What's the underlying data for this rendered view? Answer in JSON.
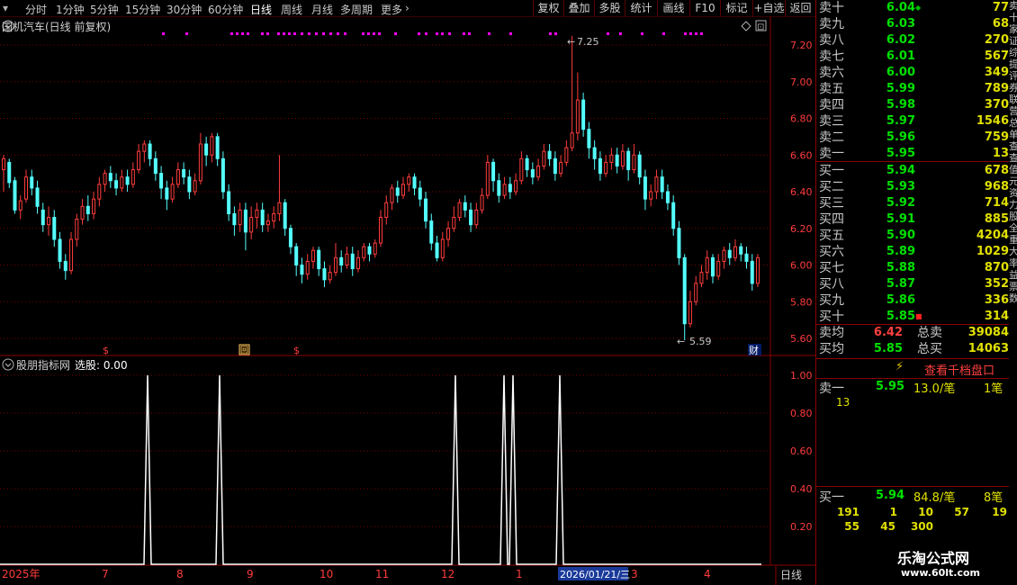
{
  "toolbar": {
    "periods": [
      "分时",
      "1分钟",
      "5分钟",
      "15分钟",
      "30分钟",
      "60分钟",
      "日线",
      "周线",
      "月线",
      "多周期",
      "更多"
    ],
    "active_period": "日线",
    "buttons": [
      "复权",
      "叠加",
      "多股",
      "统计",
      "画线",
      "F10",
      "标记",
      "+自选",
      "返回"
    ]
  },
  "main": {
    "title": "国机汽车(日线 前复权)",
    "y_labels": [
      "7.20",
      "7.00",
      "6.80",
      "6.60",
      "6.40",
      "6.20",
      "6.00",
      "5.80",
      "5.60"
    ],
    "high_label": "7.25",
    "low_label": "5.59",
    "markers": {
      "dollar": "$",
      "box": "回",
      "cai": "财"
    }
  },
  "indicator": {
    "title": "股朋指标网",
    "value_label": "选股: 0.00",
    "y_labels": [
      "1.00",
      "0.80",
      "0.60",
      "0.40",
      "0.20"
    ]
  },
  "xaxis": {
    "labels": [
      "2025年",
      "7",
      "8",
      "9",
      "10",
      "11",
      "12",
      "1",
      "2026/01/21/三",
      "3",
      "4"
    ],
    "period_label": "日线"
  },
  "chart_data": {
    "type": "candlestick",
    "price_axis": {
      "min": 5.6,
      "max": 7.2,
      "step": 0.2
    },
    "candles": [
      [
        6.52,
        6.58,
        6.6,
        6.4
      ],
      [
        6.56,
        6.45,
        6.58,
        6.42
      ],
      [
        6.46,
        6.3,
        6.48,
        6.28
      ],
      [
        6.3,
        6.35,
        6.38,
        6.25
      ],
      [
        6.36,
        6.48,
        6.52,
        6.34
      ],
      [
        6.48,
        6.42,
        6.52,
        6.38
      ],
      [
        6.42,
        6.32,
        6.46,
        6.28
      ],
      [
        6.3,
        6.22,
        6.34,
        6.18
      ],
      [
        6.22,
        6.26,
        6.32,
        6.16
      ],
      [
        6.26,
        6.14,
        6.3,
        6.1
      ],
      [
        6.14,
        6.02,
        6.18,
        5.98
      ],
      [
        6.02,
        5.97,
        6.06,
        5.92
      ],
      [
        5.97,
        6.14,
        6.18,
        5.95
      ],
      [
        6.14,
        6.25,
        6.28,
        6.1
      ],
      [
        6.25,
        6.32,
        6.36,
        6.22
      ],
      [
        6.32,
        6.28,
        6.38,
        6.24
      ],
      [
        6.28,
        6.36,
        6.4,
        6.25
      ],
      [
        6.36,
        6.44,
        6.48,
        6.32
      ],
      [
        6.44,
        6.5,
        6.52,
        6.4
      ],
      [
        6.5,
        6.46,
        6.54,
        6.42
      ],
      [
        6.46,
        6.42,
        6.5,
        6.38
      ],
      [
        6.42,
        6.48,
        6.52,
        6.4
      ],
      [
        6.48,
        6.44,
        6.52,
        6.4
      ],
      [
        6.44,
        6.52,
        6.56,
        6.42
      ],
      [
        6.52,
        6.62,
        6.66,
        6.5
      ],
      [
        6.62,
        6.66,
        6.68,
        6.56
      ],
      [
        6.66,
        6.58,
        6.68,
        6.54
      ],
      [
        6.58,
        6.5,
        6.62,
        6.46
      ],
      [
        6.5,
        6.42,
        6.54,
        6.36
      ],
      [
        6.42,
        6.36,
        6.46,
        6.3
      ],
      [
        6.36,
        6.44,
        6.48,
        6.34
      ],
      [
        6.44,
        6.52,
        6.56,
        6.42
      ],
      [
        6.52,
        6.48,
        6.56,
        6.44
      ],
      [
        6.48,
        6.4,
        6.52,
        6.36
      ],
      [
        6.4,
        6.46,
        6.5,
        6.38
      ],
      [
        6.46,
        6.66,
        6.72,
        6.44
      ],
      [
        6.66,
        6.6,
        6.7,
        6.54
      ],
      [
        6.6,
        6.7,
        6.72,
        6.56
      ],
      [
        6.7,
        6.58,
        6.72,
        6.54
      ],
      [
        6.58,
        6.4,
        6.62,
        6.36
      ],
      [
        6.4,
        6.28,
        6.44,
        6.24
      ],
      [
        6.28,
        6.22,
        6.32,
        6.16
      ],
      [
        6.22,
        6.3,
        6.34,
        6.18
      ],
      [
        6.3,
        6.18,
        6.34,
        6.08
      ],
      [
        6.18,
        6.26,
        6.32,
        6.14
      ],
      [
        6.26,
        6.3,
        6.34,
        6.2
      ],
      [
        6.3,
        6.22,
        6.34,
        6.18
      ],
      [
        6.22,
        6.24,
        6.28,
        6.18
      ],
      [
        6.24,
        6.28,
        6.32,
        6.2
      ],
      [
        6.28,
        6.34,
        6.6,
        6.24
      ],
      [
        6.34,
        6.2,
        6.36,
        6.16
      ],
      [
        6.2,
        6.1,
        6.22,
        6.06
      ],
      [
        6.1,
        6.0,
        6.12,
        5.94
      ],
      [
        6.0,
        5.95,
        6.04,
        5.9
      ],
      [
        5.95,
        6.02,
        6.06,
        5.92
      ],
      [
        6.02,
        6.08,
        6.1,
        5.98
      ],
      [
        6.08,
        5.98,
        6.1,
        5.94
      ],
      [
        5.98,
        5.92,
        6.02,
        5.88
      ],
      [
        5.92,
        5.96,
        6.0,
        5.9
      ],
      [
        5.96,
        6.04,
        6.12,
        5.94
      ],
      [
        6.04,
        6.0,
        6.08,
        5.96
      ],
      [
        6.0,
        6.06,
        6.1,
        5.98
      ],
      [
        6.06,
        5.98,
        6.1,
        5.94
      ],
      [
        5.98,
        6.04,
        6.08,
        5.96
      ],
      [
        6.04,
        6.1,
        6.12,
        6.02
      ],
      [
        6.1,
        6.06,
        6.12,
        6.02
      ],
      [
        6.06,
        6.12,
        6.14,
        6.04
      ],
      [
        6.12,
        6.26,
        6.3,
        6.1
      ],
      [
        6.26,
        6.34,
        6.38,
        6.22
      ],
      [
        6.34,
        6.42,
        6.44,
        6.3
      ],
      [
        6.42,
        6.38,
        6.46,
        6.34
      ],
      [
        6.38,
        6.44,
        6.48,
        6.36
      ],
      [
        6.44,
        6.48,
        6.5,
        6.4
      ],
      [
        6.48,
        6.42,
        6.5,
        6.38
      ],
      [
        6.42,
        6.36,
        6.46,
        6.32
      ],
      [
        6.36,
        6.24,
        6.4,
        6.2
      ],
      [
        6.24,
        6.12,
        6.28,
        6.08
      ],
      [
        6.12,
        6.04,
        6.16,
        6.02
      ],
      [
        6.04,
        6.14,
        6.18,
        6.02
      ],
      [
        6.14,
        6.2,
        6.24,
        6.1
      ],
      [
        6.2,
        6.26,
        6.32,
        6.18
      ],
      [
        6.26,
        6.34,
        6.36,
        6.24
      ],
      [
        6.34,
        6.3,
        6.38,
        6.26
      ],
      [
        6.3,
        6.22,
        6.34,
        6.18
      ],
      [
        6.22,
        6.3,
        6.34,
        6.2
      ],
      [
        6.3,
        6.38,
        6.42,
        6.28
      ],
      [
        6.38,
        6.56,
        6.6,
        6.36
      ],
      [
        6.56,
        6.46,
        6.58,
        6.4
      ],
      [
        6.46,
        6.38,
        6.5,
        6.34
      ],
      [
        6.38,
        6.44,
        6.48,
        6.36
      ],
      [
        6.44,
        6.4,
        6.48,
        6.36
      ],
      [
        6.4,
        6.46,
        6.5,
        6.38
      ],
      [
        6.46,
        6.58,
        6.62,
        6.44
      ],
      [
        6.58,
        6.52,
        6.6,
        6.48
      ],
      [
        6.52,
        6.48,
        6.56,
        6.44
      ],
      [
        6.48,
        6.54,
        6.58,
        6.46
      ],
      [
        6.54,
        6.62,
        6.66,
        6.52
      ],
      [
        6.62,
        6.58,
        6.66,
        6.54
      ],
      [
        6.58,
        6.5,
        6.62,
        6.46
      ],
      [
        6.5,
        6.56,
        6.6,
        6.48
      ],
      [
        6.56,
        6.64,
        6.68,
        6.54
      ],
      [
        6.64,
        6.72,
        7.25,
        6.62
      ],
      [
        6.72,
        6.9,
        7.05,
        6.68
      ],
      [
        6.9,
        6.74,
        6.94,
        6.7
      ],
      [
        6.74,
        6.64,
        6.78,
        6.58
      ],
      [
        6.64,
        6.58,
        6.68,
        6.52
      ],
      [
        6.58,
        6.5,
        6.62,
        6.46
      ],
      [
        6.5,
        6.56,
        6.6,
        6.48
      ],
      [
        6.56,
        6.6,
        6.64,
        6.52
      ],
      [
        6.6,
        6.54,
        6.64,
        6.5
      ],
      [
        6.54,
        6.62,
        6.66,
        6.52
      ],
      [
        6.62,
        6.52,
        6.64,
        6.46
      ],
      [
        6.52,
        6.6,
        6.66,
        6.5
      ],
      [
        6.6,
        6.48,
        6.62,
        6.44
      ],
      [
        6.48,
        6.36,
        6.52,
        6.3
      ],
      [
        6.36,
        6.4,
        6.44,
        6.32
      ],
      [
        6.4,
        6.48,
        6.52,
        6.36
      ],
      [
        6.48,
        6.4,
        6.52,
        6.36
      ],
      [
        6.4,
        6.34,
        6.44,
        6.3
      ],
      [
        6.34,
        6.2,
        6.38,
        6.16
      ],
      [
        6.2,
        6.04,
        6.24,
        6.0
      ],
      [
        6.04,
        5.68,
        6.06,
        5.59
      ],
      [
        5.68,
        5.8,
        5.86,
        5.66
      ],
      [
        5.8,
        5.9,
        5.94,
        5.78
      ],
      [
        5.9,
        5.96,
        6.0,
        5.88
      ],
      [
        5.96,
        6.04,
        6.08,
        5.92
      ],
      [
        6.04,
        5.94,
        6.06,
        5.9
      ],
      [
        5.94,
        6.02,
        6.06,
        5.92
      ],
      [
        6.02,
        6.08,
        6.1,
        5.98
      ],
      [
        6.08,
        6.04,
        6.12,
        6.0
      ],
      [
        6.04,
        6.1,
        6.14,
        6.02
      ],
      [
        6.1,
        6.06,
        6.12,
        6.02
      ],
      [
        6.06,
        6.02,
        6.1,
        5.98
      ],
      [
        6.02,
        5.9,
        6.06,
        5.86
      ],
      [
        5.9,
        6.04,
        6.06,
        5.88
      ]
    ],
    "indicator_signal": {
      "y_range": [
        0,
        1
      ],
      "signals": [
        {
          "x": 164,
          "value": 1
        },
        {
          "x": 244,
          "value": 1
        },
        {
          "x": 506,
          "value": 1
        },
        {
          "x": 560,
          "value": 1
        },
        {
          "x": 570,
          "value": 1
        },
        {
          "x": 622,
          "value": 1
        }
      ]
    }
  },
  "orderbook": {
    "asks": [
      {
        "label": "卖十",
        "price": "6.04",
        "vol": "77"
      },
      {
        "label": "卖九",
        "price": "6.03",
        "vol": "68"
      },
      {
        "label": "卖八",
        "price": "6.02",
        "vol": "270"
      },
      {
        "label": "卖七",
        "price": "6.01",
        "vol": "567"
      },
      {
        "label": "卖六",
        "price": "6.00",
        "vol": "349"
      },
      {
        "label": "卖五",
        "price": "5.99",
        "vol": "789"
      },
      {
        "label": "卖四",
        "price": "5.98",
        "vol": "370"
      },
      {
        "label": "卖三",
        "price": "5.97",
        "vol": "1546"
      },
      {
        "label": "卖二",
        "price": "5.96",
        "vol": "759"
      },
      {
        "label": "卖一",
        "price": "5.95",
        "vol": "13"
      }
    ],
    "bids": [
      {
        "label": "买一",
        "price": "5.94",
        "vol": "678"
      },
      {
        "label": "买二",
        "price": "5.93",
        "vol": "968"
      },
      {
        "label": "买三",
        "price": "5.92",
        "vol": "714"
      },
      {
        "label": "买四",
        "price": "5.91",
        "vol": "885"
      },
      {
        "label": "买五",
        "price": "5.90",
        "vol": "4204"
      },
      {
        "label": "买六",
        "price": "5.89",
        "vol": "1029"
      },
      {
        "label": "买七",
        "price": "5.88",
        "vol": "870"
      },
      {
        "label": "买八",
        "price": "5.87",
        "vol": "352"
      },
      {
        "label": "买九",
        "price": "5.86",
        "vol": "336"
      },
      {
        "label": "买十",
        "price": "5.85",
        "vol": "314"
      }
    ],
    "summary": [
      {
        "label": "卖均",
        "price": "6.42",
        "total_label": "总卖",
        "total": "39084"
      },
      {
        "label": "买均",
        "price": "5.85",
        "total_label": "总买",
        "total": "14063"
      }
    ],
    "depth_link": "查看千档盘口",
    "sell1": {
      "label": "卖一",
      "price": "5.95",
      "avg": "13.0/笔",
      "count": "1笔",
      "detail": [
        "13"
      ]
    },
    "buy1": {
      "label": "买一",
      "price": "5.94",
      "avg": "84.8/笔",
      "count": "8笔",
      "detail": [
        "191",
        "1",
        "10",
        "57",
        "19",
        "55",
        "45",
        "300"
      ]
    }
  },
  "watermark": {
    "name": "乐淘公式网",
    "url": "www.60lt.com"
  },
  "edge_text": [
    "卖",
    "十",
    "家",
    "证",
    "综",
    "提",
    "评",
    "券",
    "联",
    "营",
    "总",
    "单",
    "查",
    "查",
    "值",
    "元",
    "资",
    "力",
    "股",
    "全",
    "重",
    "大",
    "率",
    "益",
    "票",
    "数"
  ],
  "colors": {
    "up": "#ff3c3c",
    "down": "#54ffff",
    "ask_price": "#00e000",
    "bid_price": "#00e000",
    "grid": "#7a0000",
    "purple": "#ff00ff"
  }
}
